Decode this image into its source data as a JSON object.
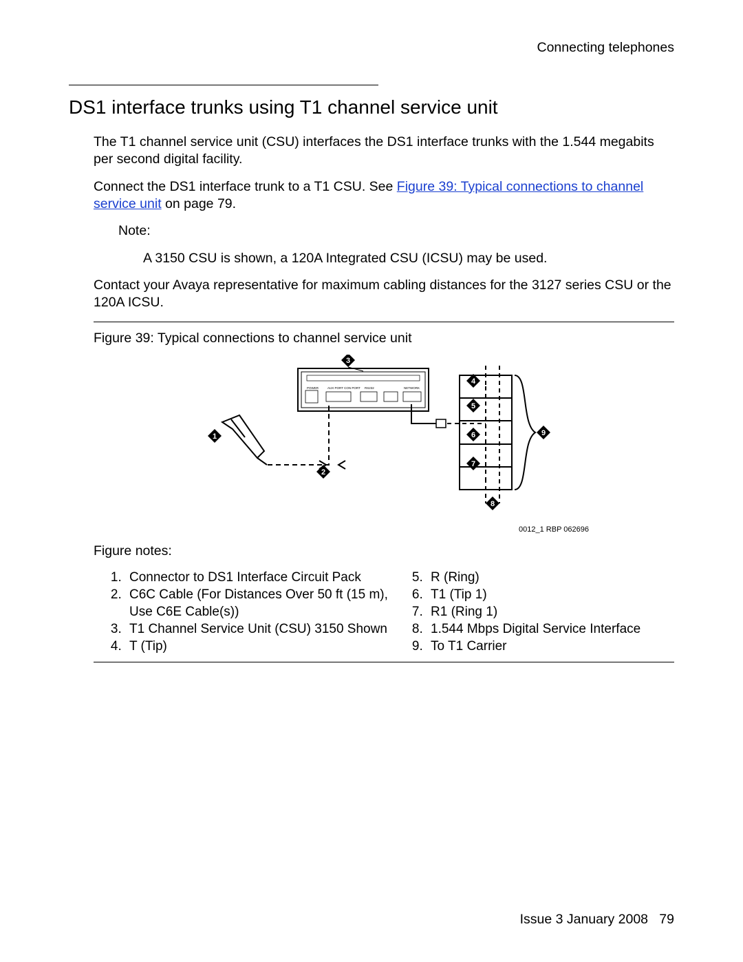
{
  "header": {
    "chapter": "Connecting telephones"
  },
  "section": {
    "title": "DS1 interface trunks using T1 channel service unit",
    "para1": "The T1 channel service unit (CSU) interfaces the DS1 interface trunks with the 1.544 megabits per second digital facility.",
    "para2_pre": "Connect the DS1 interface trunk to a T1 CSU. See ",
    "para2_link": "Figure 39:  Typical connections to channel service unit",
    "para2_post": " on page 79.",
    "note_label": "Note:",
    "note_body": "A 3150 CSU is shown, a 120A Integrated CSU (ICSU) may be used.",
    "para3": "Contact your Avaya representative for maximum cabling distances for the 3127 series CSU or the 120A ICSU."
  },
  "figure": {
    "caption": "Figure 39: Typical connections to channel service unit",
    "diagram_id": "0012_1 RBP 062696",
    "callouts": [
      "1",
      "2",
      "3",
      "4",
      "5",
      "6",
      "7",
      "8",
      "9"
    ],
    "notes_label": "Figure notes:",
    "notes_left": [
      "Connector to DS1 Interface Circuit Pack",
      "C6C Cable (For Distances Over 50 ft (15 m), Use C6E Cable(s))",
      "T1 Channel Service Unit (CSU) 3150 Shown",
      "T (Tip)"
    ],
    "notes_right": [
      "R (Ring)",
      "T1 (Tip 1)",
      "R1 (Ring 1)",
      "1.544 Mbps Digital Service Interface",
      "To T1 Carrier"
    ]
  },
  "footer": {
    "issue": "Issue 3   January 2008",
    "page": "79"
  }
}
